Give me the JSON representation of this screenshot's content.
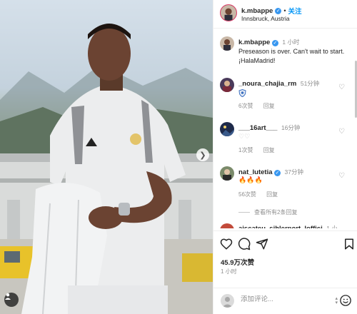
{
  "post": {
    "username": "k.mbappe",
    "follow_label": "关注",
    "separator": "•",
    "location": "Innsbruck, Austria",
    "verified": true
  },
  "caption": {
    "username": "k.mbappe",
    "time": "1 小时",
    "text": "Preseason is over. Can't wait to start. ¡HalaMadrid!"
  },
  "comments": [
    {
      "username": "_noura_chajia_rm",
      "time": "51分钟",
      "likes": "6次赞",
      "reply": "回复"
    },
    {
      "username": "___16art___",
      "time": "16分钟",
      "likes": "1次赞",
      "reply": "回复"
    },
    {
      "username": "nat_lutetia",
      "time": "37分钟",
      "likes": "56次赞",
      "reply": "回复"
    }
  ],
  "more_replies": "查看所有2条回复",
  "partial_comment_user": "aiscateu_sihlerport_loffici",
  "partial_comment_time": "1 小",
  "actions": {
    "likes": "45.9万次赞",
    "time": "1 小时"
  },
  "add_comment": {
    "placeholder": "添加评论..."
  },
  "colors": {
    "link_blue": "#0095f6",
    "verified_blue": "#3897f0",
    "muted": "#8e8e8e",
    "text": "#262626"
  }
}
